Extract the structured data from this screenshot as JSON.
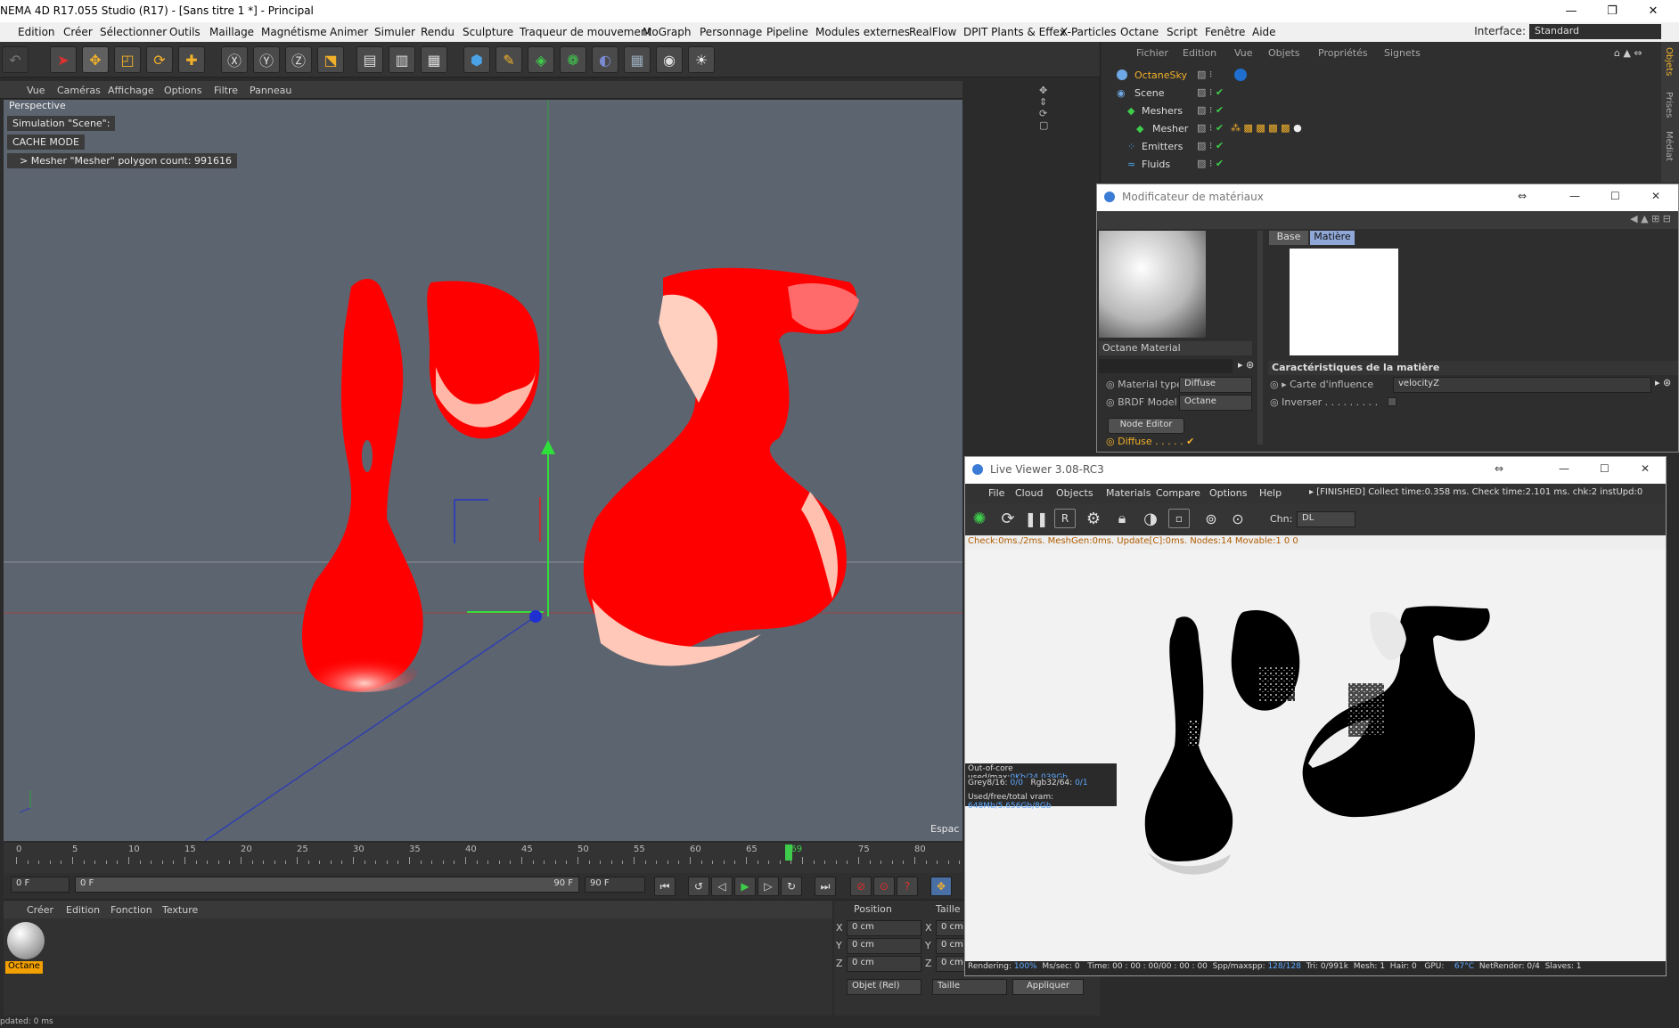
{
  "title": "NEMA 4D R17.055 Studio (R17) - [Sans titre 1 *] - Principal",
  "menu": [
    "Edition",
    "Créer",
    "Sélectionner",
    "Outils",
    "Maillage",
    "Magnétisme",
    "Animer",
    "Simuler",
    "Rendu",
    "Sculpture",
    "Traqueur de mouvement",
    "MoGraph",
    "Personnage",
    "Pipeline",
    "Modules externes",
    "RealFlow",
    "DPIT Plants & Effex",
    "X-Particles",
    "Octane",
    "Script",
    "Fenêtre",
    "Aide"
  ],
  "interface": {
    "label": "Interface:",
    "value": "Standard"
  },
  "viewport": {
    "menu": [
      "Vue",
      "Caméras",
      "Affichage",
      "Options",
      "Filtre",
      "Panneau"
    ],
    "name": "Perspective",
    "overlay": [
      "Simulation \"Scene\":",
      "CACHE MODE",
      "> Mesher \"Mesher\" polygon count: 991616"
    ],
    "corner_label": "Espac"
  },
  "timeline": {
    "ticks": [
      "0",
      "5",
      "10",
      "15",
      "20",
      "25",
      "30",
      "35",
      "40",
      "45",
      "50",
      "55",
      "60",
      "65",
      "69",
      "75",
      "80"
    ],
    "current": 69,
    "start_field": "0 F",
    "slider_left": "0 F",
    "slider_right": "90 F",
    "end_field": "90 F"
  },
  "material_manager": {
    "menu": [
      "Créer",
      "Edition",
      "Fonction",
      "Texture"
    ],
    "material_name": "Octane"
  },
  "coords": {
    "position_label": "Position",
    "size_label": "Taille",
    "rows": [
      {
        "axis": "X",
        "value": "0 cm",
        "size": "0 cm"
      },
      {
        "axis": "Y",
        "value": "0 cm",
        "size": "0 cm"
      },
      {
        "axis": "Z",
        "value": "0 cm",
        "size": "0 cm"
      }
    ],
    "mode": "Objet (Rel)",
    "size_mode": "Taille",
    "apply": "Appliquer"
  },
  "status": "pdated: 0 ms",
  "objects": {
    "menu": [
      "Fichier",
      "Edition",
      "Vue",
      "Objets",
      "Propriétés",
      "Signets"
    ],
    "rows": [
      "OctaneSky",
      "Scene",
      "Meshers",
      "Mesher",
      "Emitters",
      "Fluids"
    ],
    "side_tabs": [
      "Objets",
      "Prises",
      "Médiat"
    ]
  },
  "material_editor": {
    "title": "Modificateur de matériaux",
    "material_name": "Octane Material",
    "tabs": [
      "Base",
      "Matière"
    ],
    "props": [
      {
        "label": "Material type",
        "value": "Diffuse"
      },
      {
        "label": "BRDF Model",
        "value": "Octane"
      }
    ],
    "node_editor": "Node Editor",
    "diffuse_label": "Diffuse",
    "section_title": "Caractéristiques de la matière",
    "influence_label": "Carte d'influence",
    "influence_value": "velocityZ",
    "invert_label": "Inverser"
  },
  "live_viewer": {
    "title": "Live Viewer 3.08-RC3",
    "menu": [
      "File",
      "Cloud",
      "Objects",
      "Materials",
      "Compare",
      "Options",
      "Help"
    ],
    "status_line": "[FINISHED] Collect time:0.358 ms.  Check time:2.101 ms.  chk:2  instUpd:0",
    "channel_label": "Chn:",
    "channel_value": "DL",
    "info": "Check:0ms./2ms. MeshGen:0ms. Update[C]:0ms. Nodes:14 Movable:1  0 0",
    "outcore": {
      "label": "Out-of-core used/max:",
      "value": "0Kb/24.039Gb"
    },
    "grey": {
      "label": "Grey8/16:",
      "value": "0/0"
    },
    "rgb": {
      "label": "Rgb32/64:",
      "value": "0/1"
    },
    "vram": {
      "label": "Used/free/total vram:",
      "value": "648Mb/5.656Gb/8Gb"
    },
    "bottom": {
      "rendering_label": "Rendering:",
      "rendering": "100%",
      "mssec": "Ms/sec: 0",
      "time": "Time: 00 : 00 : 00/00 : 00 : 00",
      "spp": "Spp/maxspp:",
      "spp_value": "128/128",
      "tri": "Tri: 0/991k",
      "mesh": "Mesh: 1",
      "hair": "Hair: 0",
      "gpu": "GPU:",
      "temp": "67°C",
      "netrender": "NetRender: 0/4",
      "slaves": "Slaves: 1"
    }
  },
  "colors": {
    "fluid": "#ff0000",
    "viewport_bg": "#5c6470",
    "timeline_marker": "#3ecc4b"
  }
}
